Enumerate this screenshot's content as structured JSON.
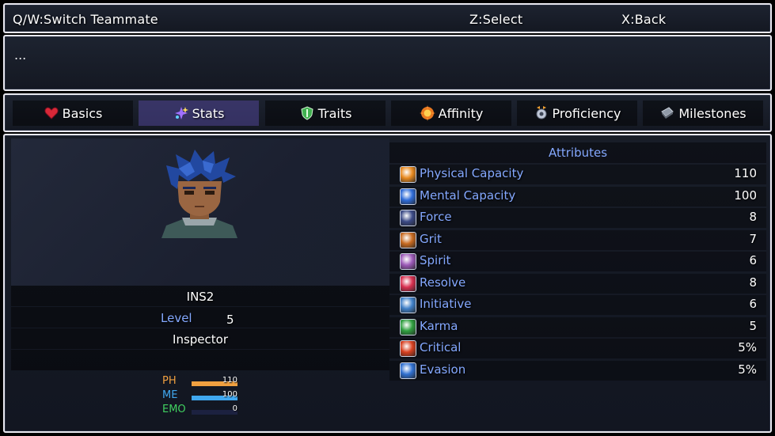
{
  "controls": {
    "switch": "Q/W:Switch Teammate",
    "select": "Z:Select",
    "back": "X:Back"
  },
  "help": {
    "text": "..."
  },
  "tabs": [
    {
      "label": "Basics",
      "icon": "heart-icon"
    },
    {
      "label": "Stats",
      "icon": "sparkle-icon"
    },
    {
      "label": "Traits",
      "icon": "shield-icon"
    },
    {
      "label": "Affinity",
      "icon": "flame-icon"
    },
    {
      "label": "Proficiency",
      "icon": "gear-icon"
    },
    {
      "label": "Milestones",
      "icon": "book-icon"
    }
  ],
  "active_tab": "Stats",
  "character": {
    "name": "INS2",
    "level_label": "Level",
    "level": "5",
    "class": "Inspector",
    "gauges": [
      {
        "label": "PH",
        "value": "110",
        "fill": 1.0,
        "color": "#f0a040",
        "label_color": "#f0a040"
      },
      {
        "label": "ME",
        "value": "100",
        "fill": 1.0,
        "color": "#40a8f0",
        "label_color": "#40a8f0"
      },
      {
        "label": "EMO",
        "value": "0",
        "fill": 0.0,
        "color": "#40d060",
        "label_color": "#40d060"
      }
    ]
  },
  "attributes": {
    "title": "Attributes",
    "rows": [
      {
        "name": "Physical Capacity",
        "value": "110",
        "icon": "orange-orb-icon",
        "color": "#e88a20"
      },
      {
        "name": "Mental Capacity",
        "value": "100",
        "icon": "blue-orb-icon",
        "color": "#2f6cd8"
      },
      {
        "name": "Force",
        "value": "8",
        "icon": "fist-icon",
        "color": "#3b4a86"
      },
      {
        "name": "Grit",
        "value": "7",
        "icon": "shield-icon",
        "color": "#c86a20"
      },
      {
        "name": "Spirit",
        "value": "6",
        "icon": "book-icon",
        "color": "#9c5ab8"
      },
      {
        "name": "Resolve",
        "value": "8",
        "icon": "heart-icon",
        "color": "#d83050"
      },
      {
        "name": "Initiative",
        "value": "6",
        "icon": "runner-icon",
        "color": "#4080c8"
      },
      {
        "name": "Karma",
        "value": "5",
        "icon": "clover-icon",
        "color": "#30a040"
      },
      {
        "name": "Critical",
        "value": "5%",
        "icon": "critical-icon",
        "color": "#d84020"
      },
      {
        "name": "Evasion",
        "value": "5%",
        "icon": "evasion-icon",
        "color": "#3070d0"
      }
    ]
  }
}
